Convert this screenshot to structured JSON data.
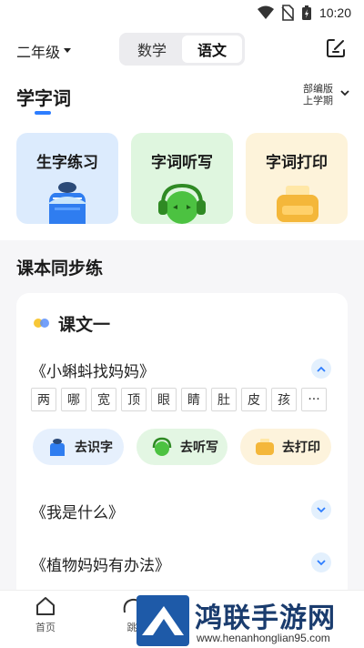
{
  "status_bar": {
    "time": "10:20"
  },
  "header": {
    "grade_label": "二年级",
    "subject_tabs": [
      {
        "label": "数学",
        "active": false
      },
      {
        "label": "语文",
        "active": true
      }
    ]
  },
  "section_main": {
    "title": "学字词",
    "edition_line1": "部编版",
    "edition_line2": "上学期"
  },
  "feature_cards": [
    {
      "label": "生字练习",
      "icon": "pen-cup-icon"
    },
    {
      "label": "字词听写",
      "icon": "headphone-monster-icon"
    },
    {
      "label": "字词打印",
      "icon": "printer-icon"
    }
  ],
  "sync_section": {
    "title": "课本同步练"
  },
  "lesson": {
    "title": "课文一",
    "articles": [
      {
        "title": "《小蝌蚪找妈妈》",
        "expanded": true
      },
      {
        "title": "《我是什么》",
        "expanded": false
      },
      {
        "title": "《植物妈妈有办法》",
        "expanded": false
      }
    ],
    "chars": [
      "两",
      "哪",
      "宽",
      "顶",
      "眼",
      "睛",
      "肚",
      "皮",
      "孩",
      "···"
    ],
    "actions": [
      {
        "label": "去识字"
      },
      {
        "label": "去听写"
      },
      {
        "label": "去打印"
      }
    ]
  },
  "bottom_nav": {
    "items": [
      {
        "label": "首页"
      },
      {
        "label": "跳"
      }
    ]
  },
  "watermark": {
    "title": "鸿联手游网",
    "url": "www.henanhonglian95.com"
  },
  "colors": {
    "accent": "#2d7dff",
    "card_blue": "#dcebfd",
    "card_green": "#dff6df",
    "card_yellow": "#fdf3da"
  }
}
